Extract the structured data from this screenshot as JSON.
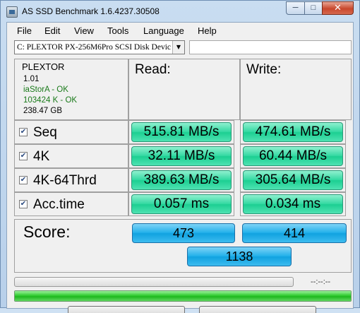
{
  "window": {
    "title": "AS SSD Benchmark 1.6.4237.30508",
    "minimize_glyph": "─",
    "maximize_glyph": "□",
    "close_glyph": "✕"
  },
  "menu": [
    "File",
    "Edit",
    "View",
    "Tools",
    "Language",
    "Help"
  ],
  "drive": {
    "selected": "C: PLEXTOR PX-256M6Pro SCSI Disk Devic",
    "dropdown_icon": "chevron-down-icon",
    "extra_field_value": ""
  },
  "info": {
    "model": "PLEXTOR",
    "firmware": "1.01",
    "driver_status": "iaStorA - OK",
    "alignment_status": "103424 K - OK",
    "capacity": "238.47 GB"
  },
  "headers": {
    "read": "Read:",
    "write": "Write:"
  },
  "tests": [
    {
      "label": "Seq",
      "checked": true,
      "read": "515.81 MB/s",
      "write": "474.61 MB/s"
    },
    {
      "label": "4K",
      "checked": true,
      "read": "32.11 MB/s",
      "write": "60.44 MB/s"
    },
    {
      "label": "4K-64Thrd",
      "checked": true,
      "read": "389.63 MB/s",
      "write": "305.64 MB/s"
    },
    {
      "label": "Acc.time",
      "checked": true,
      "read": "0.057 ms",
      "write": "0.034 ms"
    }
  ],
  "score": {
    "label": "Score:",
    "read": "473",
    "write": "414",
    "total": "1138"
  },
  "progress": {
    "time_text": "--:--:--",
    "run_fraction": 0,
    "total_fraction": 1
  },
  "colors": {
    "result_green": "#34d9a2",
    "score_blue": "#22b0ea",
    "info_green": "#1a7a1a",
    "progress_green": "#33cc33"
  },
  "checkmark": "☑"
}
